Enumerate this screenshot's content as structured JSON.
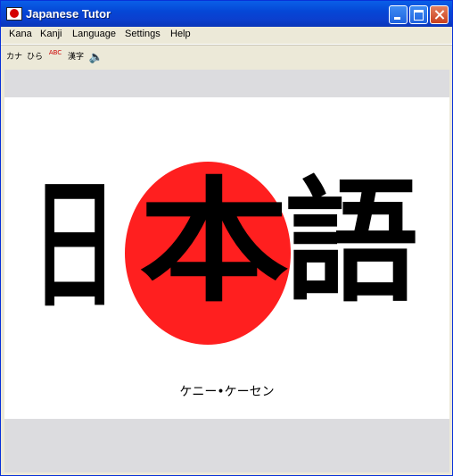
{
  "window": {
    "title": "Japanese Tutor"
  },
  "menu": {
    "items": [
      "Kana",
      "Kanji",
      "Language",
      "Settings",
      "Help"
    ]
  },
  "toolbar": {
    "buttons": [
      "カナ",
      "ひら",
      "ABC",
      "漢字",
      "🔈"
    ]
  },
  "splash": {
    "kanji": [
      "日",
      "本",
      "語"
    ],
    "sun_color": "#ff1f1f",
    "subtitle": "ケニー•ケーセン"
  }
}
